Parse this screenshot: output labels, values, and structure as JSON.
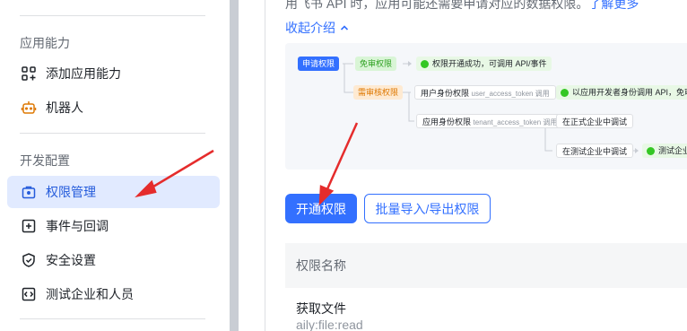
{
  "sidebar": {
    "section_app": "应用能力",
    "items_app": [
      {
        "label": "添加应用能力",
        "icon": "grid-add-icon"
      },
      {
        "label": "机器人",
        "icon": "robot-icon"
      }
    ],
    "section_dev": "开发配置",
    "items_dev": [
      {
        "label": "权限管理",
        "icon": "lock-icon",
        "active": true
      },
      {
        "label": "事件与回调",
        "icon": "plus-square-icon"
      },
      {
        "label": "安全设置",
        "icon": "shield-icon"
      },
      {
        "label": "测试企业和人员",
        "icon": "code-icon"
      }
    ]
  },
  "main": {
    "intro_text": "用飞书 API 时，应用可能还需要申请对应的数据权限。",
    "intro_link": "了解更多",
    "collapse_label": "收起介绍",
    "diagram": {
      "apply": "申请权限",
      "free": "免审权限",
      "free_result": "权限开通成功，可调用 API/事件",
      "review": "需审核权限",
      "user_perm": "用户身份权限",
      "user_token": "user_access_token 调用",
      "user_result": "以应用开发者身份调用 API，免审",
      "app_perm": "应用身份权限",
      "app_token": "tenant_access_token 调用",
      "formal_debug": "在正式企业中调试",
      "test_debug": "在测试企业中调试",
      "test_result": "测试企业"
    },
    "buttons": {
      "open": "开通权限",
      "batch": "批量导入/导出权限"
    },
    "table": {
      "header": "权限名称",
      "rows": [
        {
          "name": "获取文件",
          "scope": "aily:file:read"
        }
      ]
    }
  },
  "colors": {
    "accent": "#3370ff",
    "active_bg": "#e1eaff",
    "arrow": "#e52c2c"
  }
}
